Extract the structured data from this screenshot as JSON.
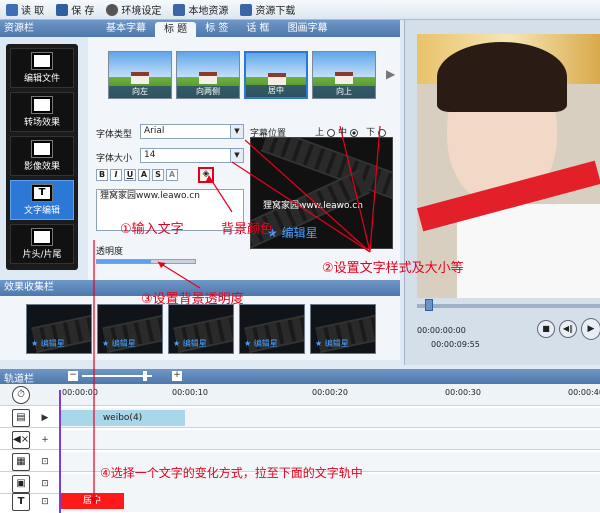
{
  "toolbar": {
    "read": "读 取",
    "save": "保 存",
    "settings": "环境设定",
    "local": "本地资源",
    "download": "资源下载"
  },
  "resource_panel": {
    "title": "资源栏"
  },
  "tabs": [
    "基本字幕",
    "标 题",
    "标 签",
    "话 框",
    "图画字幕"
  ],
  "sidebar": [
    "编辑文件",
    "转场效果",
    "影像效果",
    "文字编辑",
    "片头/片尾"
  ],
  "thumbs": [
    "向左",
    "向两侧",
    "居中",
    "向上"
  ],
  "font": {
    "type_label": "字体类型",
    "type_value": "Arial",
    "size_label": "字体大小",
    "size_value": "14",
    "position_label": "字幕位置",
    "pos_top": "上",
    "pos_mid": "中",
    "pos_bottom": "下",
    "format_buttons": [
      "B",
      "I",
      "U",
      "A",
      "S",
      "A"
    ],
    "text_value": "狸窝家园www.leawo.cn",
    "opacity_label": "透明度",
    "opacity": 0.55
  },
  "preview": {
    "caption": "狸窝家园www.leawo.cn",
    "watermark": "编辑星"
  },
  "effects": {
    "title": "效果收集栏",
    "watermark": "编辑星"
  },
  "player": {
    "time_current": "00:00:00:00",
    "time_total": "00:00:09:55"
  },
  "timeline": {
    "title": "轨道栏",
    "ticks": [
      "00:00:00",
      "00:00:10",
      "00:00:20",
      "00:00:30",
      "00:00:40"
    ],
    "video_clip": "weibo(4)",
    "text_clip": "居中"
  },
  "annotations": {
    "step1": "①输入文字",
    "bg_color": "背景颜色",
    "step2": "②设置文字样式及大小等",
    "step3": "③设置背景透明度",
    "step4": "④选择一个文字的变化方式，拉至下面的文字轨中"
  },
  "colors": {
    "accent": "#2b78d6",
    "annotation": "#e8001b",
    "text_clip": "#ff1a1a",
    "video_clip": "#a9d6e8"
  }
}
